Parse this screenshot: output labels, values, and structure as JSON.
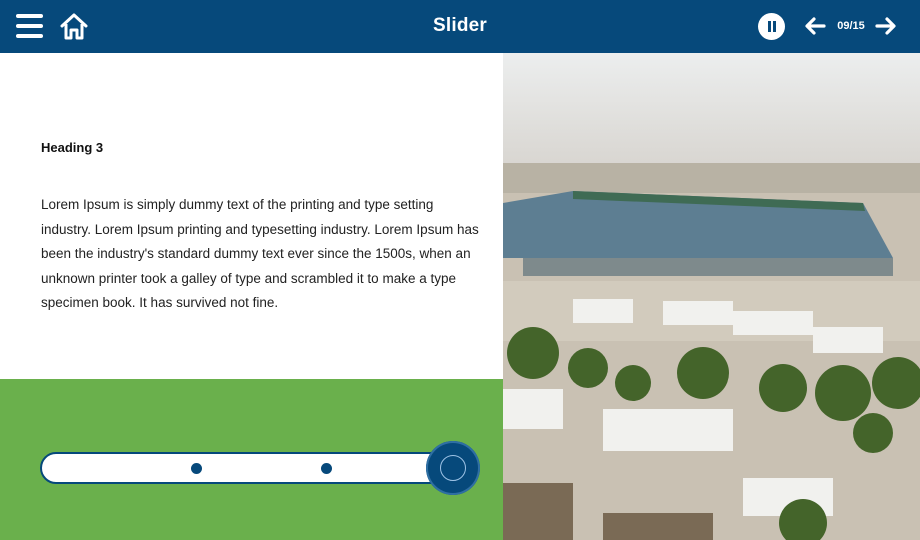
{
  "header": {
    "title": "Slider",
    "page_counter": "09/15",
    "colors": {
      "bar": "#06497b",
      "icon": "#ffffff"
    },
    "icons": [
      "hamburger-menu-icon",
      "home-icon",
      "pause-icon",
      "arrow-left-icon",
      "arrow-right-icon"
    ]
  },
  "content": {
    "heading": "Heading 3",
    "paragraph": "Lorem Ipsum is simply dummy text of the printing and type setting industry. Lorem Ipsum printing and typesetting industry. Lorem Ipsum has been the industry's standard dummy text ever since the 1500s, when an unknown printer took a galley of type and scrambled it to make a type specimen book. It has survived not fine."
  },
  "slider": {
    "background": "#6ab04c",
    "track_color": "#ffffff",
    "accent": "#06497b",
    "stops": 3,
    "current_value_fraction": 1.0
  },
  "image": {
    "subject": "photo",
    "colors": {
      "sky": "#e8eaea",
      "roof": "#5f7f92",
      "trees": "#4b6b2c",
      "ground": "#c8c0b3"
    }
  }
}
